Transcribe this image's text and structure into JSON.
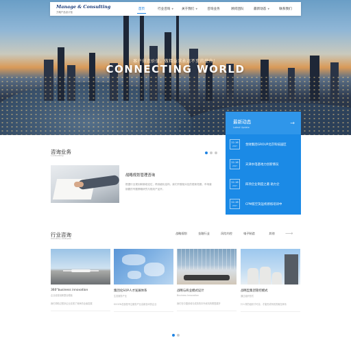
{
  "nav": {
    "logo_title": "Manage & Consulting",
    "logo_sub": "方略产品设计馆",
    "items": [
      {
        "label": "首页",
        "active": true,
        "caret": false
      },
      {
        "label": "行业咨询",
        "active": false,
        "caret": true
      },
      {
        "label": "关于我们",
        "active": false,
        "caret": true
      },
      {
        "label": "咨询业务",
        "active": false,
        "caret": false
      },
      {
        "label": "顾问团队",
        "active": false,
        "caret": false
      },
      {
        "label": "最新动态",
        "active": false,
        "caret": true
      },
      {
        "label": "联系我们",
        "active": false,
        "caret": false
      }
    ]
  },
  "hero": {
    "tagline": "客户创造价值，做精益求永远不变的使命！",
    "title": "CONNECTING WORLD"
  },
  "news": {
    "title": "最新动态",
    "subtitle": "Latest Update",
    "arrow": "→",
    "items": [
      {
        "date": "12-16",
        "year": "2017",
        "title": "金财集团GROUP北京科技园区"
      },
      {
        "date": "12-16",
        "year": "2017",
        "title": "天津水电基地力创新情况"
      },
      {
        "date": "12-16",
        "year": "2017",
        "title": "四项企业制度之著 助力企"
      },
      {
        "date": "12-16",
        "year": "2017",
        "title": "CPM航空货运机修核培训中"
      }
    ]
  },
  "consulting": {
    "title": "咨询业务",
    "subtitle": "Consulting",
    "item_title": "战略规划管理咨询",
    "item_desc": "根据行业规划和脉络定位，再到细化结构，我们开展相对应的更新拓展，市场营销要的专题策略研究与规划产品开。"
  },
  "industry": {
    "title": "行业咨询",
    "subtitle": "Industry Analysis",
    "tabs": [
      "战略规划",
      "金融行业",
      "风险内控",
      "电子制造",
      "其他"
    ],
    "arrow": "⟶",
    "cards": [
      {
        "title": "360°business innovation",
        "sub": "企业经营创新整合模板",
        "desc": "我们帮助过很多企业实现了竞争的全面发展"
      },
      {
        "title": "集团化SOP人才发展体系",
        "sub": "生态服务产业",
        "desc": "KOGEN总部是专注服务产业高新技术的企业"
      },
      {
        "title": "战略与商业模式设计",
        "sub": "Business Innovation",
        "desc": "我们在中国领域与成熟的中外资机构联盟展开"
      },
      {
        "title": "战略型集团管控模式",
        "sub": "通过组织形式",
        "desc": "什么样的组织才可靠，才能形成有效的管控体系"
      }
    ]
  }
}
